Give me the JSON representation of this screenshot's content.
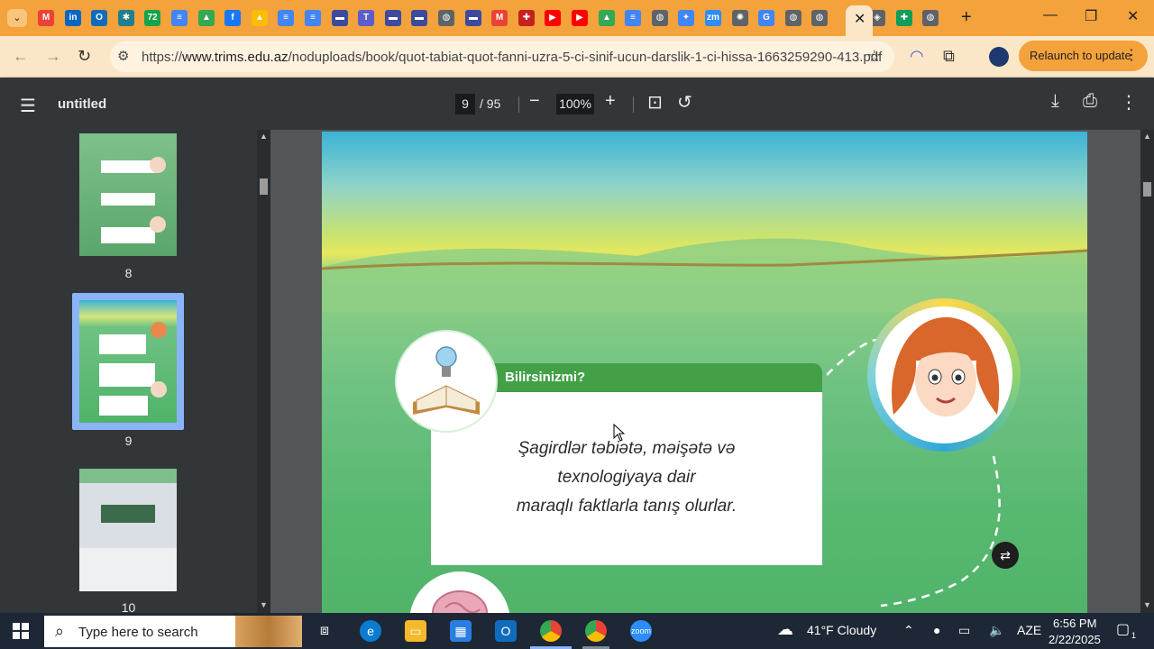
{
  "browser": {
    "tab_menu_icon": "chevron-down-icon",
    "active_tab_close": "✕",
    "new_tab": "+",
    "window": {
      "minimize": "—",
      "restore": "❐",
      "close": "✕"
    },
    "url_prefix": "https://",
    "url_host": "www.trims.edu.az",
    "url_path": "/noduploads/book/quot-tabiat-quot-fanni-uzra-5-ci-sinif-ucun-darslik-1-ci-hissa-1663259290-413.pdf",
    "relaunch_label": "Relaunch to update",
    "favicons": [
      {
        "name": "gmail-icon",
        "glyph": "M",
        "color": "#ea4335"
      },
      {
        "name": "linkedin-icon",
        "glyph": "in",
        "color": "#0a66c2"
      },
      {
        "name": "outlook-icon",
        "glyph": "O",
        "color": "#0f6cbd"
      },
      {
        "name": "perplexity-icon",
        "glyph": "✱",
        "color": "#20808d"
      },
      {
        "name": "chatbot-icon",
        "glyph": "72",
        "color": "#17a34a"
      },
      {
        "name": "google-docs-icon",
        "glyph": "≡",
        "color": "#4285f4"
      },
      {
        "name": "google-drive-icon",
        "glyph": "▲",
        "color": "#34a853"
      },
      {
        "name": "facebook-icon",
        "glyph": "f",
        "color": "#1877f2"
      },
      {
        "name": "google-drive-icon",
        "glyph": "▲",
        "color": "#fbbc04"
      },
      {
        "name": "google-docs-icon",
        "glyph": "≡",
        "color": "#4285f4"
      },
      {
        "name": "google-docs-icon",
        "glyph": "≡",
        "color": "#4285f4"
      },
      {
        "name": "meet-icon",
        "glyph": "▬",
        "color": "#3c4b9e"
      },
      {
        "name": "teams-icon",
        "glyph": "T",
        "color": "#5b5fc7"
      },
      {
        "name": "meet-icon",
        "glyph": "▬",
        "color": "#3c4b9e"
      },
      {
        "name": "meet-icon",
        "glyph": "▬",
        "color": "#3c4b9e"
      },
      {
        "name": "globe-icon",
        "glyph": "◍",
        "color": "#5f6368"
      },
      {
        "name": "meet-icon",
        "glyph": "▬",
        "color": "#3c4b9e"
      },
      {
        "name": "gmail-icon",
        "glyph": "M",
        "color": "#ea4335"
      },
      {
        "name": "extension-icon",
        "glyph": "✚",
        "color": "#c5221f"
      },
      {
        "name": "youtube-icon",
        "glyph": "▶",
        "color": "#ff0000"
      },
      {
        "name": "youtube-icon",
        "glyph": "▶",
        "color": "#ff0000"
      },
      {
        "name": "google-drive-icon",
        "glyph": "▲",
        "color": "#34a853"
      },
      {
        "name": "google-docs-icon",
        "glyph": "≡",
        "color": "#4285f4"
      },
      {
        "name": "globe-icon",
        "glyph": "◍",
        "color": "#5f6368"
      },
      {
        "name": "gemini-icon",
        "glyph": "✦",
        "color": "#4285f4"
      },
      {
        "name": "zoom-icon",
        "glyph": "zm",
        "color": "#2d8cff"
      },
      {
        "name": "settings-icon",
        "glyph": "✺",
        "color": "#5f6368"
      },
      {
        "name": "google-icon",
        "glyph": "G",
        "color": "#4285f4"
      },
      {
        "name": "globe-icon",
        "glyph": "◍",
        "color": "#5f6368"
      },
      {
        "name": "globe-icon",
        "glyph": "◍",
        "color": "#5f6368"
      },
      {
        "name": "shield-icon",
        "glyph": "◈",
        "color": "#5f6368"
      },
      {
        "name": "sheets-icon",
        "glyph": "✚",
        "color": "#0f9d58"
      },
      {
        "name": "globe-icon",
        "glyph": "◍",
        "color": "#5f6368"
      }
    ]
  },
  "pdf": {
    "title": "untitled",
    "current_page": "9",
    "total_pages": "/ 95",
    "zoom": "100%",
    "thumbnails": [
      {
        "label": "8"
      },
      {
        "label": "9"
      },
      {
        "label": "10"
      }
    ]
  },
  "page_content": {
    "box_title": "Bilirsinizmi?",
    "lines": [
      "Şagirdlər təbiətə, məişətə və",
      "texnologiyaya dair",
      "maraqlı faktlarla tanış olurlar."
    ]
  },
  "taskbar": {
    "search_placeholder": "Type here to search",
    "weather": "41°F  Cloudy",
    "language": "AZE",
    "time": "6:56 PM",
    "date": "2/22/2025",
    "notifications": "1"
  },
  "colors": {
    "tab_strip": "#f4a23c",
    "toolbar": "#fbe7c8",
    "pdf_dark": "#323639",
    "thumb_selected": "#8ab4f8",
    "box_green": "#43a047"
  }
}
